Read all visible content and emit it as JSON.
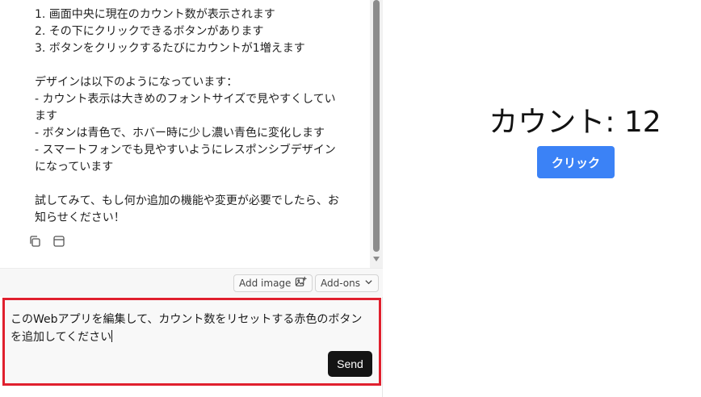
{
  "chat": {
    "lines": [
      "1. 画面中央に現在のカウント数が表示されます",
      "2. その下にクリックできるボタンがあります",
      "3. ボタンをクリックするたびにカウントが1増えます",
      "",
      "デザインは以下のようになっています：",
      "- カウント表示は大きめのフォントサイズで見やすくしてい",
      "ます",
      "- ボタンは青色で、ホバー時に少し濃い青色に変化します",
      "- スマートフォンでも見やすいようにレスポンシブデザイン",
      "になっています",
      "",
      "試してみて、もし何か追加の機能や変更が必要でしたら、お",
      "知らせください！"
    ],
    "actions": [
      {
        "icon": "copy-icon"
      },
      {
        "icon": "window-icon"
      }
    ]
  },
  "toolbar": {
    "add_image_label": "Add image",
    "add_ons_label": "Add-ons"
  },
  "input": {
    "line1": "このWebアプリを編集して、カウント数をリセットする赤色のボタン",
    "line2": "を追加してください"
  },
  "send_label": "Send",
  "preview": {
    "counter_text": "カウント: 12",
    "button_label": "クリック"
  },
  "colors": {
    "accent_blue": "#3b82f6",
    "highlight_red": "#e0202e",
    "send_bg": "#141414"
  }
}
